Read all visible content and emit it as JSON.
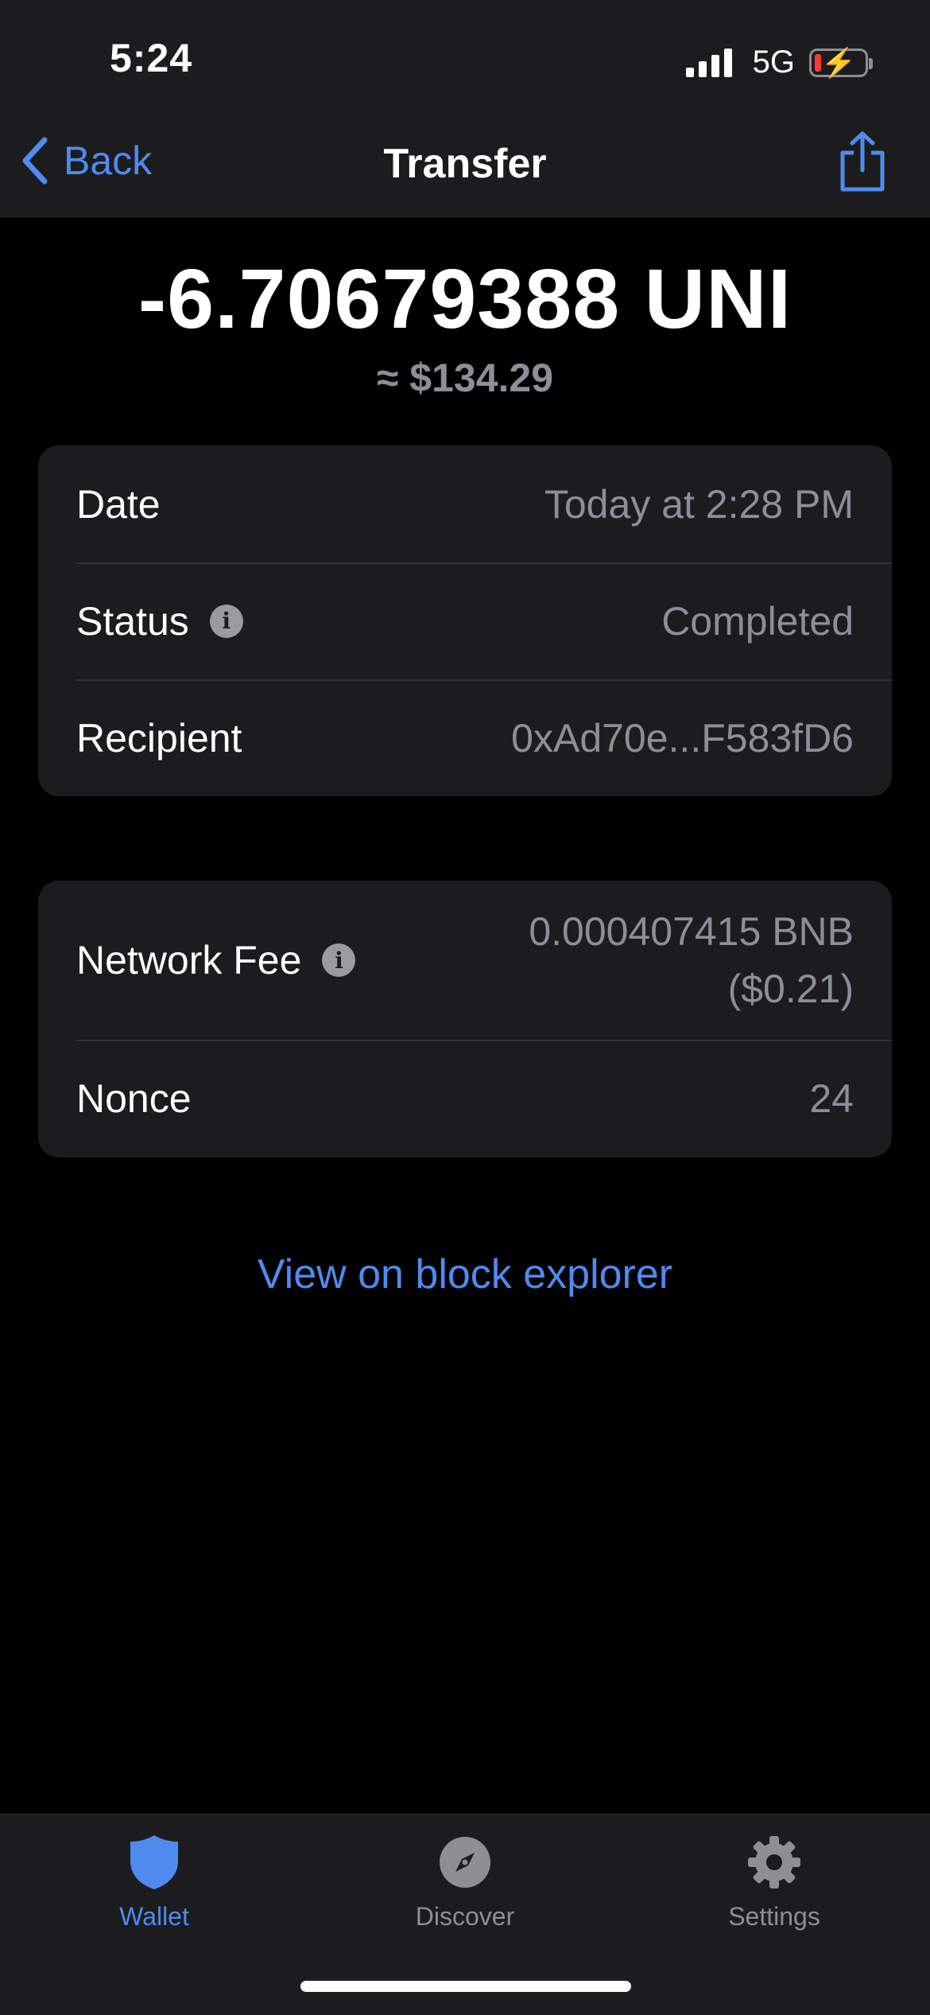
{
  "status_bar": {
    "time": "5:24",
    "network": "5G"
  },
  "nav": {
    "back_label": "Back",
    "title": "Transfer"
  },
  "transaction": {
    "amount": "-6.70679388 UNI",
    "fiat": "≈ $134.29"
  },
  "details": [
    {
      "label": "Date",
      "value": "Today at 2:28 PM"
    },
    {
      "label": "Status",
      "value": "Completed"
    },
    {
      "label": "Recipient",
      "value": "0xAd70e...F583fD6"
    }
  ],
  "fees": {
    "network_fee_label": "Network Fee",
    "network_fee_crypto": "0.000407415 BNB",
    "network_fee_fiat": "($0.21)",
    "nonce_label": "Nonce",
    "nonce_value": "24"
  },
  "explorer_link": "View on block explorer",
  "tabbar": {
    "items": [
      {
        "label": "Wallet",
        "icon": "shield-icon",
        "active": true
      },
      {
        "label": "Discover",
        "icon": "compass-icon",
        "active": false
      },
      {
        "label": "Settings",
        "icon": "gear-icon",
        "active": false
      }
    ]
  },
  "colors": {
    "accent": "#4f8bef",
    "background": "#000000",
    "card": "#1c1c1e",
    "secondary_text": "#8a8f99"
  }
}
